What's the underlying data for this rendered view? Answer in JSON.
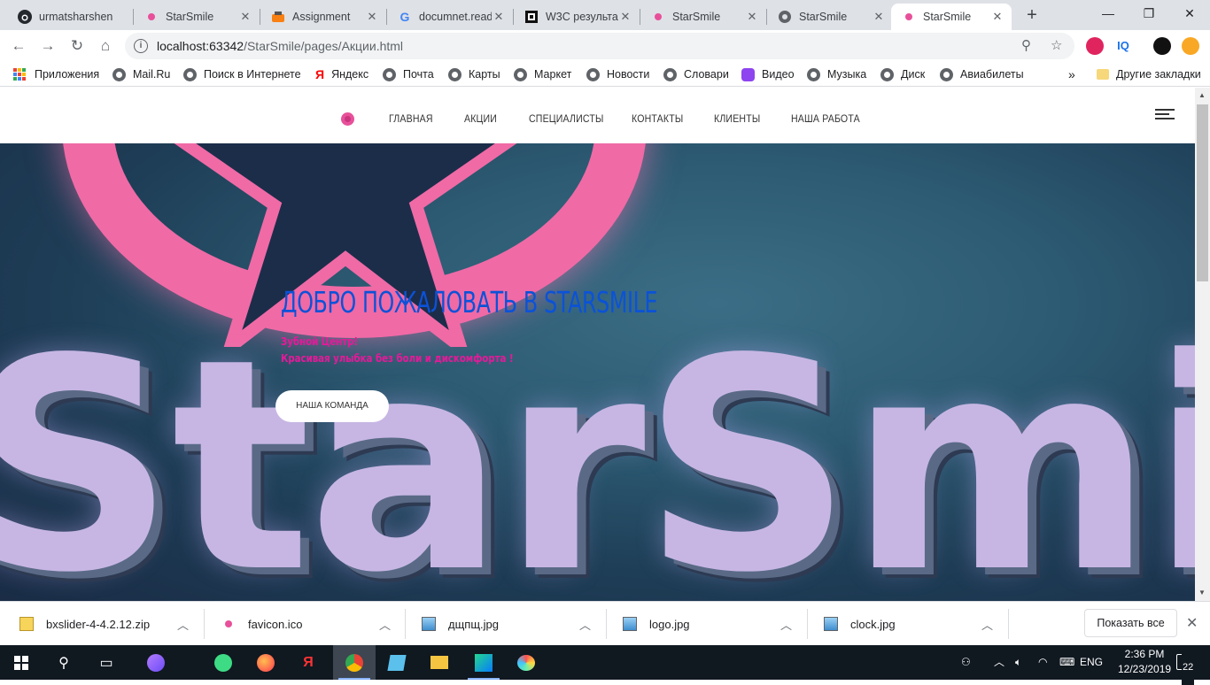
{
  "browser": {
    "tabs": [
      {
        "title": "urmatsharshen",
        "icon": "github-icon"
      },
      {
        "title": "StarSmile",
        "icon": "starsmile-favicon-icon"
      },
      {
        "title": "Assignment",
        "icon": "moodle-icon"
      },
      {
        "title": "documnet.read",
        "icon": "google-icon"
      },
      {
        "title": "W3C результа",
        "icon": "w3c-icon"
      },
      {
        "title": "StarSmile",
        "icon": "starsmile-favicon-icon"
      },
      {
        "title": "StarSmile",
        "icon": "globe-icon"
      },
      {
        "title": "StarSmile",
        "icon": "starsmile-favicon-icon",
        "active": true
      }
    ],
    "url_host": "localhost:63342",
    "url_path": "/StarSmile/pages/Акции.html",
    "bookmarks": [
      {
        "label": "Приложения",
        "icon": "apps-grid-icon"
      },
      {
        "label": "Mail.Ru",
        "icon": "globe-icon"
      },
      {
        "label": "Поиск в Интернете",
        "icon": "globe-icon"
      },
      {
        "label": "Яндекс",
        "icon": "yandex-icon"
      },
      {
        "label": "Почта",
        "icon": "globe-icon"
      },
      {
        "label": "Карты",
        "icon": "globe-icon"
      },
      {
        "label": "Маркет",
        "icon": "globe-icon"
      },
      {
        "label": "Новости",
        "icon": "globe-icon"
      },
      {
        "label": "Словари",
        "icon": "globe-icon"
      },
      {
        "label": "Видео",
        "icon": "video-icon"
      },
      {
        "label": "Музыка",
        "icon": "globe-icon"
      },
      {
        "label": "Диск",
        "icon": "globe-icon"
      },
      {
        "label": "Авиабилеты",
        "icon": "globe-icon"
      }
    ],
    "bookmarks_overflow": "»",
    "other_bookmarks": "Другие закладки"
  },
  "site": {
    "nav": [
      "ГЛАВНАЯ",
      "АКЦИИ",
      "СПЕЦИАЛИСТЫ",
      "КОНТАКТЫ",
      "КЛИЕНТЫ",
      "НАША РАБОТА"
    ],
    "hero": {
      "title": "ДОБРО ПОЖАЛОВАТЬ В STARSMILE",
      "subtitle1": "Зубной Центр!",
      "subtitle2": "Красивая улыбка без боли и дискомфорта !",
      "button": "НАША КОМАНДА",
      "background_word": "StarSmil"
    },
    "colors": {
      "title": "#0b52d8",
      "subtitle": "#e8189a",
      "accent": "#e8509a"
    }
  },
  "downloads": {
    "items": [
      {
        "name": "bxslider-4-4.2.12.zip",
        "icon": "zip-file-icon"
      },
      {
        "name": "favicon.ico",
        "icon": "starsmile-favicon-icon"
      },
      {
        "name": "дщпщ.jpg",
        "icon": "image-file-icon"
      },
      {
        "name": "logo.jpg",
        "icon": "image-file-icon"
      },
      {
        "name": "clock.jpg",
        "icon": "image-file-icon"
      }
    ],
    "show_all": "Показать все"
  },
  "taskbar": {
    "lang": "ENG",
    "time": "2:36 PM",
    "date": "12/23/2019",
    "notifications": "22"
  }
}
